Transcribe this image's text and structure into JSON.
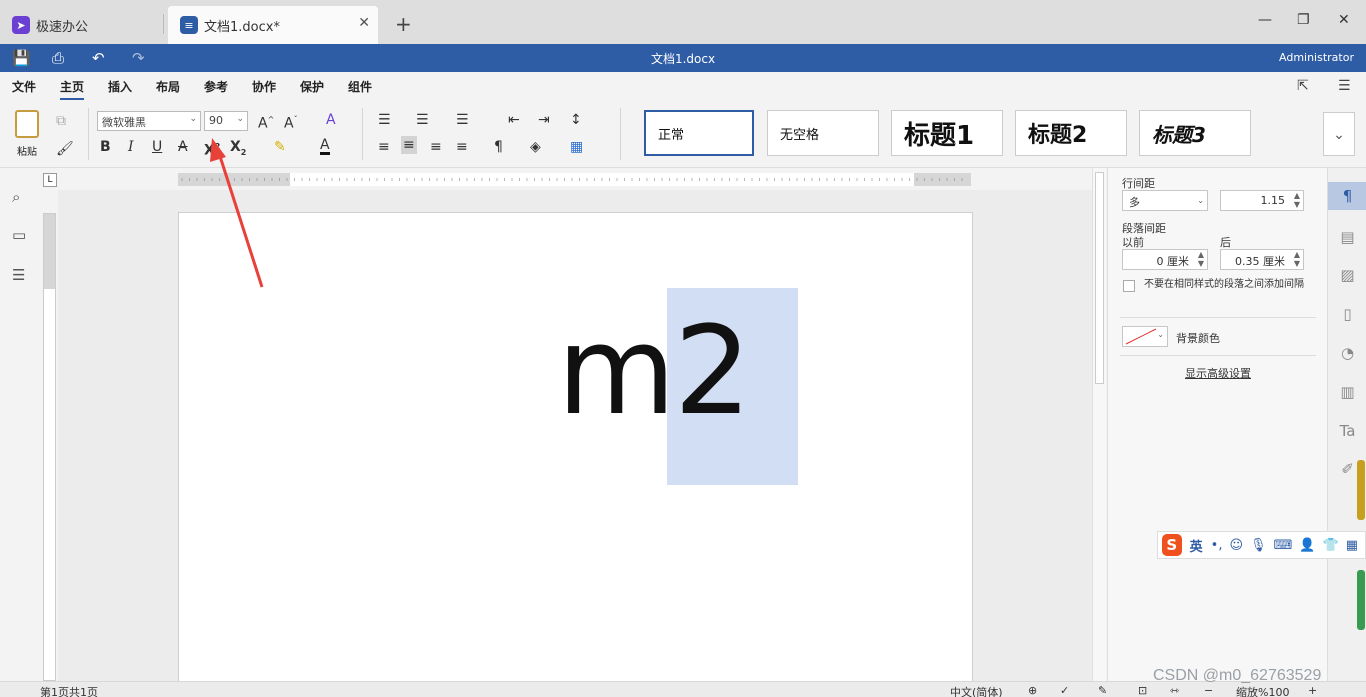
{
  "tabs": {
    "home_label": "极速办公",
    "doc_label": "文档1.docx*",
    "close": "✕",
    "new_tab": "+"
  },
  "window": {
    "minimize": "—",
    "maximize": "❐",
    "close": "✕"
  },
  "titlebar": {
    "title": "文档1.docx",
    "user": "Administrator"
  },
  "menu": [
    "文件",
    "主页",
    "插入",
    "布局",
    "参考",
    "协作",
    "保护",
    "组件"
  ],
  "ribbon": {
    "paste_label": "粘贴",
    "font_name": "微软雅黑",
    "font_size": "90",
    "styles": [
      "正常",
      "无空格",
      "标题1",
      "标题2",
      "标题3"
    ]
  },
  "document": {
    "base_text": "m",
    "superscript_text": "2"
  },
  "right_panel": {
    "line_spacing_label": "行间距",
    "line_spacing_mode": "多",
    "line_spacing_value": "1.15",
    "para_spacing_label": "段落间距",
    "before_label": "以前",
    "after_label": "后",
    "before_value": "0 厘米",
    "after_value": "0.35 厘米",
    "checkbox_label": "不要在相同样式的段落之间添加间隔",
    "bg_color_label": "背景颜色",
    "advanced_link": "显示高级设置"
  },
  "ime": {
    "lang": "英",
    "punct": "•,"
  },
  "status": {
    "page_info": "第1页共1页",
    "language": "中文(简体)",
    "zoom": "缩放%100"
  },
  "watermark": "CSDN @m0_62763529",
  "colors": {
    "title_bar": "#2e5ca5",
    "selection": "#d2def3",
    "arrow": "#e8413a"
  }
}
